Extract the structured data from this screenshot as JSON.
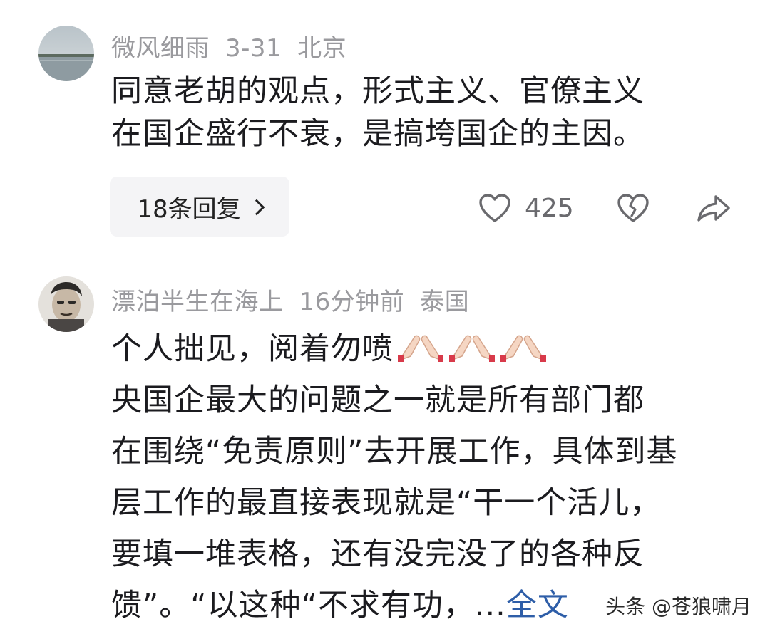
{
  "comments": [
    {
      "username": "微风细雨",
      "date": "3-31",
      "location": "北京",
      "lines": [
        "同意老胡的观点，形式主义、官僚主义",
        "在国企盛行不衰，是搞垮国企的主因。"
      ],
      "replies_label": "18条回复",
      "likes": "425"
    },
    {
      "username": "漂泊半生在海上",
      "date": "16分钟前",
      "location": "泰国",
      "first_line": "个人拙见，阅着勿喷",
      "lines": [
        "央国企最大的问题之一就是所有部门都",
        "在围绕“免责原则”去开展工作，具体到基",
        "层工作的最直接表现就是“干一个活儿，",
        "要填一堆表格，还有没完没了的各种反"
      ],
      "last_line": "馈”。“以这种“不求有功，...",
      "more_label": "全文"
    }
  ],
  "watermark": "头条 @苍狼啸月",
  "icons": {
    "like": "heart-outline-icon",
    "dislike": "broken-heart-icon",
    "share": "share-arrow-icon",
    "emoji": "folded-hands-emoji"
  },
  "colors": {
    "link": "#2e5ea8",
    "meta": "#9a9a9e",
    "text": "#1b1b1f"
  }
}
